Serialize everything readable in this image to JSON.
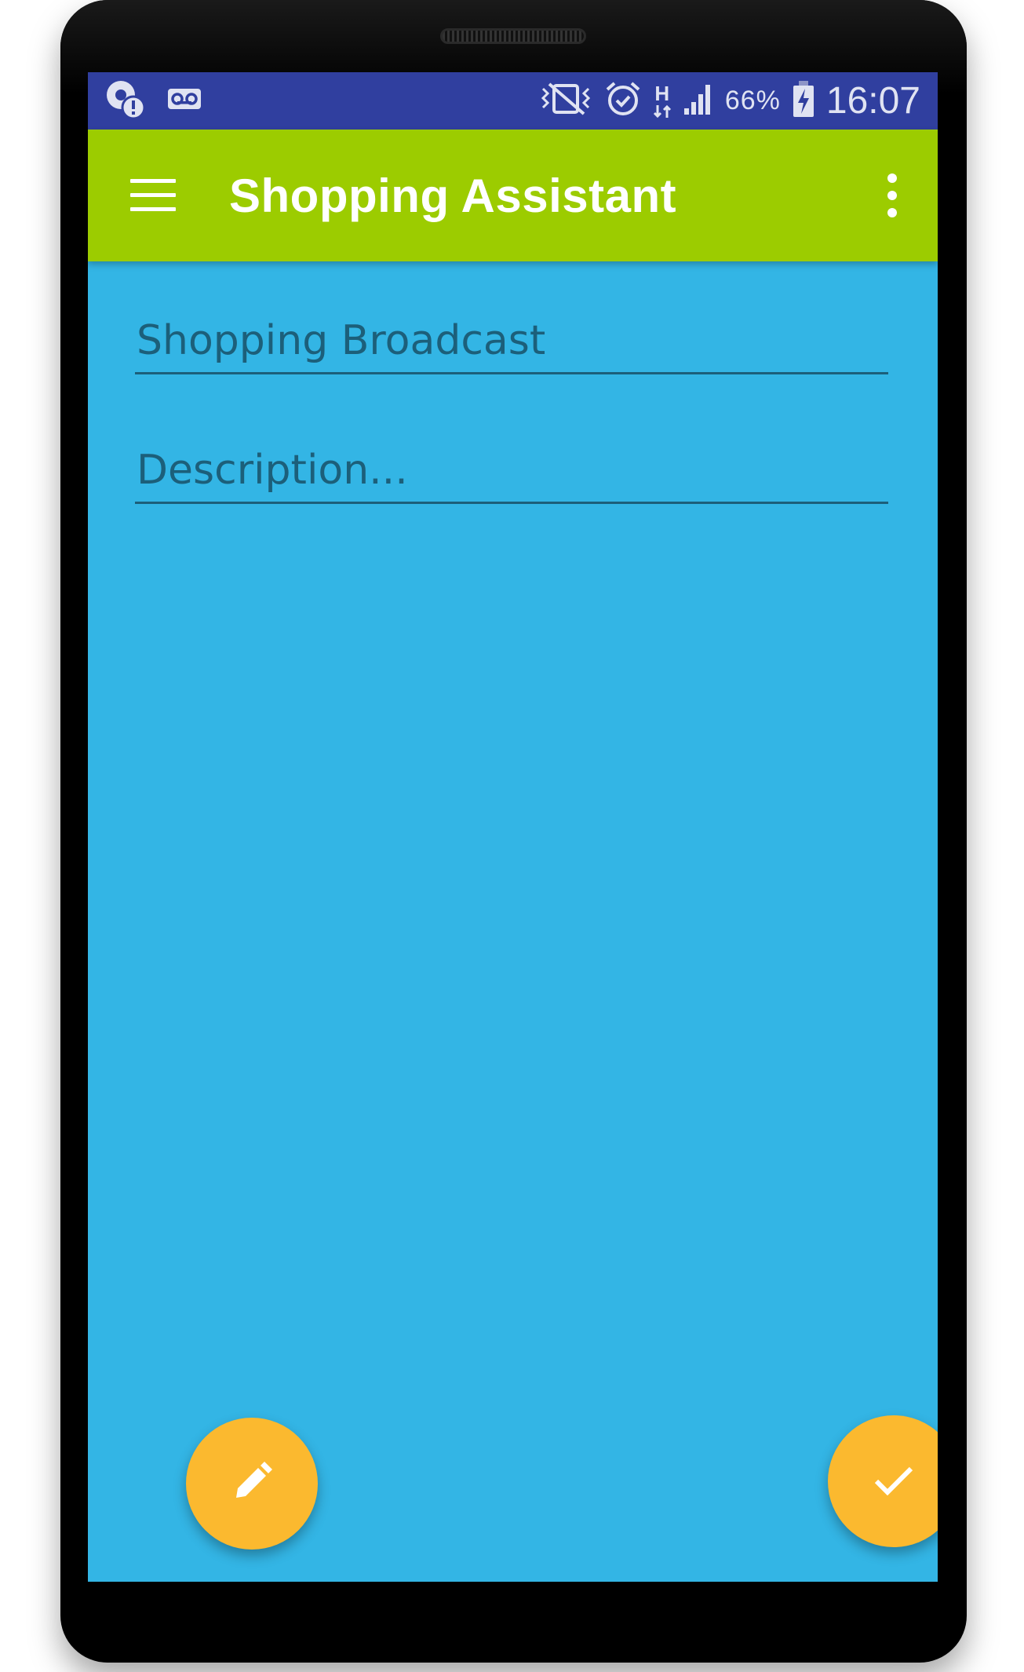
{
  "status_bar": {
    "battery_percent": "66%",
    "network_type": "H",
    "time": "16:07"
  },
  "app_bar": {
    "title": "Shopping Assistant"
  },
  "form": {
    "title_field": {
      "value": "Shopping Broadcast",
      "placeholder": ""
    },
    "description_field": {
      "value": "",
      "placeholder": "Description..."
    }
  },
  "colors": {
    "status_bar": "#303f9f",
    "app_bar": "#9ccc00",
    "background": "#33b5e5",
    "fab": "#fbb92f",
    "field_text": "#1c5f7a"
  },
  "icons": {
    "status_left": [
      "location-alert-icon",
      "voicemail-icon"
    ],
    "status_right": [
      "vibrate-icon",
      "alarm-icon",
      "network-type-icon",
      "signal-icon",
      "battery-charging-icon"
    ],
    "app_bar": [
      "menu-icon",
      "more-vert-icon"
    ],
    "fabs": [
      "pencil-icon",
      "check-icon"
    ]
  }
}
